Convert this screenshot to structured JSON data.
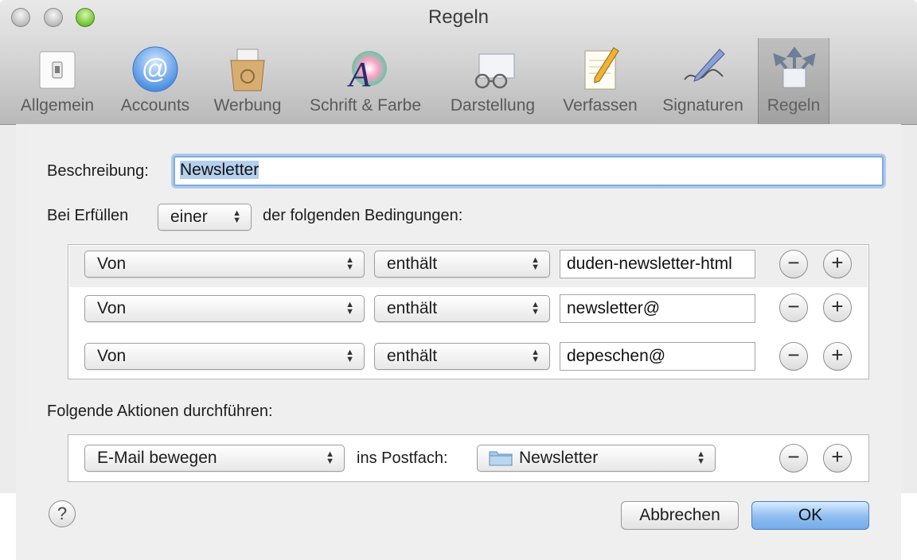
{
  "window": {
    "title": "Regeln"
  },
  "toolbar": {
    "items": [
      {
        "label": "Allgemein",
        "icon": "general-switch-icon"
      },
      {
        "label": "Accounts",
        "icon": "at-sign-icon"
      },
      {
        "label": "Werbung",
        "icon": "junk-mail-bin-icon"
      },
      {
        "label": "Schrift & Farbe",
        "icon": "font-color-icon"
      },
      {
        "label": "Darstellung",
        "icon": "glasses-envelope-icon"
      },
      {
        "label": "Verfassen",
        "icon": "compose-pencil-icon"
      },
      {
        "label": "Signaturen",
        "icon": "signature-pen-icon"
      },
      {
        "label": "Regeln",
        "icon": "rules-arrows-icon"
      }
    ],
    "active": "Regeln"
  },
  "rule": {
    "description_label": "Beschreibung:",
    "description_value": "Newsletter",
    "condition_prefix": "Bei Erfüllen",
    "condition_match": "einer",
    "condition_suffix": "der folgenden Bedingungen:",
    "conditions": [
      {
        "field": "Von",
        "operator": "enthält",
        "value": "duden-newsletter-html"
      },
      {
        "field": "Von",
        "operator": "enthält",
        "value": "newsletter@"
      },
      {
        "field": "Von",
        "operator": "enthält",
        "value": "depeschen@"
      }
    ],
    "actions_label": "Folgende Aktionen durchführen:",
    "actions": [
      {
        "action": "E-Mail bewegen",
        "connector": "ins Postfach:",
        "mailbox": "Newsletter"
      }
    ]
  },
  "buttons": {
    "remove": "−",
    "add": "+",
    "help": "?",
    "cancel": "Abbrechen",
    "ok": "OK"
  },
  "colors": {
    "ok_button": "#8ebdf0",
    "focus_ring": "#7cace3"
  }
}
